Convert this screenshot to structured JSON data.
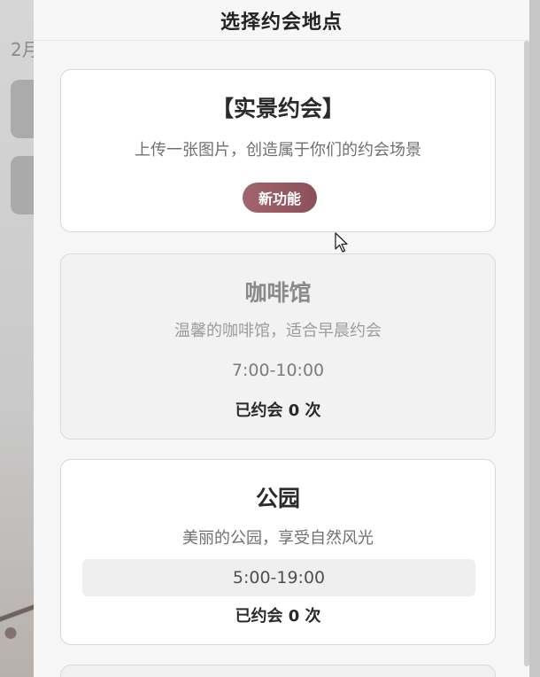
{
  "background": {
    "date_text": "2月"
  },
  "modal": {
    "title": "选择约会地点"
  },
  "cards": [
    {
      "title": "【实景约会】",
      "description": "上传一张图片，创造属于你们的约会场景",
      "badge": "新功能"
    },
    {
      "title": "咖啡馆",
      "description": "温馨的咖啡馆，适合早晨约会",
      "time": "7:00-10:00",
      "count": "已约会 0 次"
    },
    {
      "title": "公园",
      "description": "美丽的公园，享受自然风光",
      "time": "5:00-19:00",
      "count": "已约会 0 次"
    }
  ],
  "icons": {
    "cursor": "mouse-cursor-icon"
  }
}
